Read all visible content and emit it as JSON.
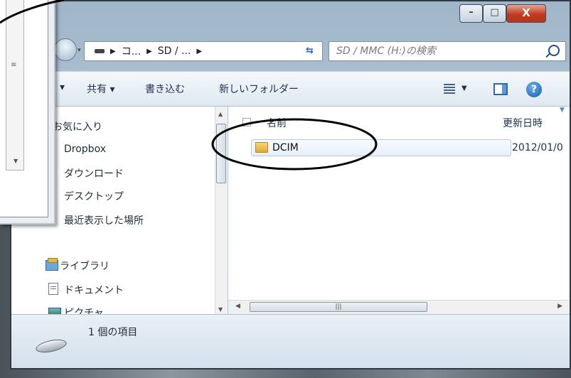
{
  "window_controls": {
    "minimize": "–",
    "maximize": "□",
    "close": "X"
  },
  "address": {
    "crumbs": [
      "コ...",
      "SD / ...",
      ""
    ],
    "search_placeholder": "SD / MMC (H:)の検索"
  },
  "toolbar": {
    "share": "共有 ▾",
    "burn": "書き込む",
    "new_folder": "新しいフォルダー"
  },
  "nav": {
    "favorites": "お気に入り",
    "items": [
      "Dropbox",
      "ダウンロード",
      "デスクトップ",
      "最近表示した場所"
    ],
    "libraries": "ライブラリ",
    "library_items": [
      "ドキュメント",
      "ピクチャ"
    ]
  },
  "columns": {
    "name": "名前",
    "date": "更新日時"
  },
  "files": [
    {
      "name": "DCIM",
      "date": "2012/01/0"
    }
  ],
  "status": {
    "count": "1 個の項目"
  },
  "colors": {
    "title_bg": "#b9cedd",
    "close_btn": "#c23a20",
    "annotation": "#000000"
  }
}
